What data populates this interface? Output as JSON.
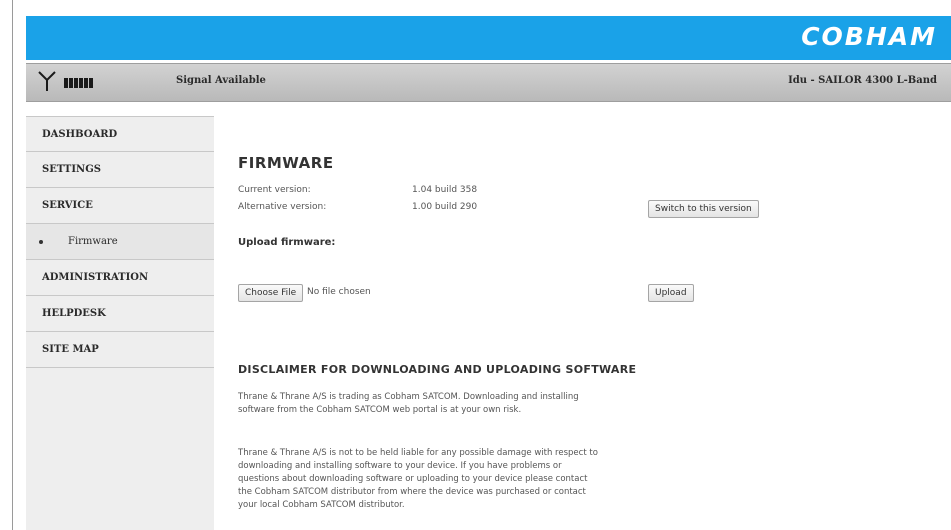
{
  "header": {
    "brand": "COBHAM",
    "signal_status": "Signal Available",
    "device": "Idu - SAILOR 4300 L-Band",
    "signal_bars": 6,
    "colors": {
      "topbar": "#1aa2e8",
      "statusbar": "#c4c4c4"
    },
    "icons": [
      "antenna-icon",
      "signal-strength-icon"
    ]
  },
  "sidebar": {
    "items": [
      {
        "label": "DASHBOARD"
      },
      {
        "label": "SETTINGS"
      },
      {
        "label": "SERVICE"
      },
      {
        "label": "Firmware"
      },
      {
        "label": "ADMINISTRATION"
      },
      {
        "label": "HELPDESK"
      },
      {
        "label": "SITE MAP"
      }
    ]
  },
  "main": {
    "title": "FIRMWARE",
    "current": {
      "label": "Current version:",
      "value": "1.04 build 358"
    },
    "alternative": {
      "label": "Alternative version:",
      "value": "1.00 build 290"
    },
    "switch_button": "Switch to this version",
    "upload_heading": "Upload firmware:",
    "choose_file_button": "Choose File",
    "file_status": "No file chosen",
    "upload_button": "Upload",
    "disclaimer": {
      "title": "DISCLAIMER FOR DOWNLOADING AND UPLOADING SOFTWARE",
      "paragraph1": "Thrane & Thrane A/S is trading as Cobham SATCOM. Downloading and installing software from the Cobham SATCOM web portal is at your own risk.",
      "paragraph2": "Thrane & Thrane A/S is not to be held liable for any possible damage with respect to downloading and installing software to your device. If you have problems or questions about downloading software or uploading to your device please contact the Cobham SATCOM distributor from where the device was purchased or contact your local Cobham SATCOM distributor."
    }
  }
}
